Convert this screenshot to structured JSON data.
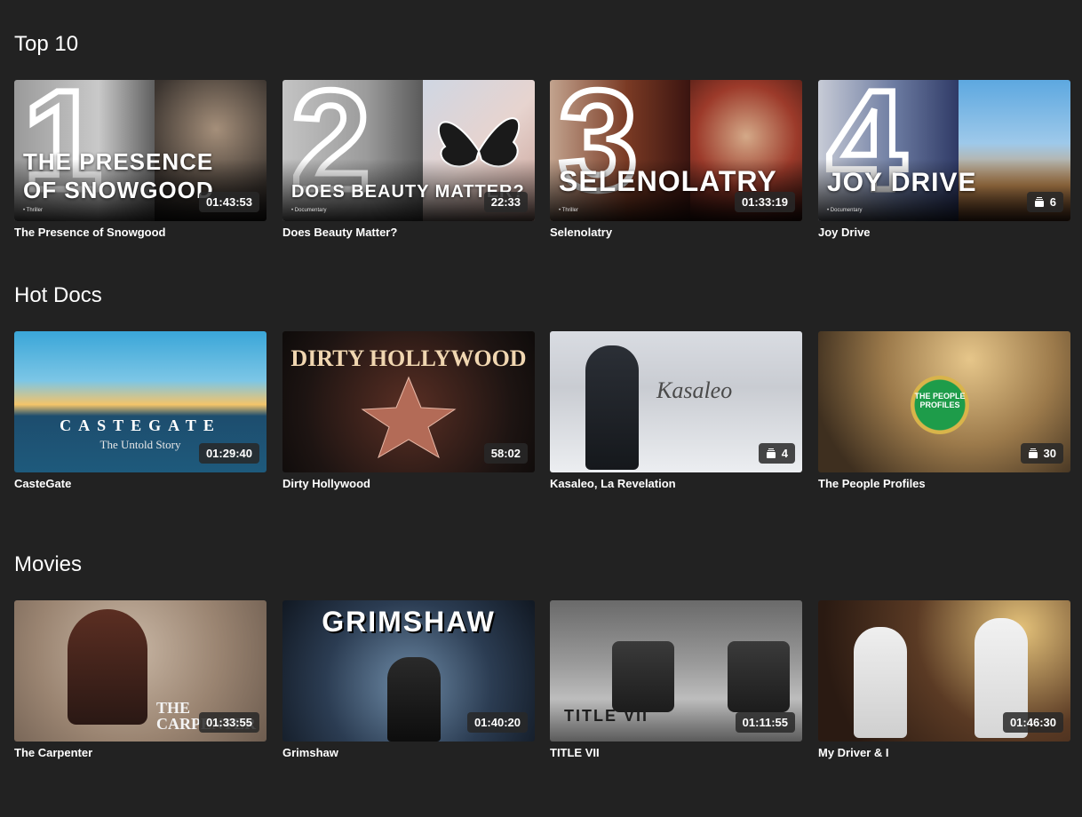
{
  "sections": [
    {
      "title": "Top 10",
      "items": [
        {
          "rank": "1",
          "title": "The Presence of Snowgood",
          "overlay": "THE PRESENCE OF SNOWGOOD",
          "genre": "• Thriller",
          "badge": "01:43:53"
        },
        {
          "rank": "2",
          "title": "Does Beauty Matter?",
          "overlay": "DOES BEAUTY MATTER?",
          "genre": "• Documentary",
          "badge": "22:33"
        },
        {
          "rank": "3",
          "title": "Selenolatry",
          "overlay": "SELENOLATRY",
          "genre": "• Thriller",
          "badge": "01:33:19"
        },
        {
          "rank": "4",
          "title": "Joy Drive",
          "overlay": "JOY DRIVE",
          "genre": "• Documentary",
          "badge": "6",
          "badge_icon": "episodes-icon"
        }
      ]
    },
    {
      "title": "Hot Docs",
      "items": [
        {
          "title": "CasteGate",
          "badge": "01:29:40",
          "poster_text": "CASTEGATE",
          "poster_sub": "The Untold Story"
        },
        {
          "title": "Dirty Hollywood",
          "badge": "58:02",
          "poster_text": "DIRTY HOLLYWOOD"
        },
        {
          "title": "Kasaleo, La Revelation",
          "badge": "4",
          "badge_icon": "episodes-icon",
          "poster_text": "Kasaleo"
        },
        {
          "title": "The People Profiles",
          "badge": "30",
          "badge_icon": "episodes-icon",
          "poster_text": "THE PEOPLE PROFILES"
        }
      ]
    },
    {
      "title": "Movies",
      "items": [
        {
          "title": "The Carpenter",
          "badge": "01:33:55",
          "poster_text": "THE CARPENTER"
        },
        {
          "title": "Grimshaw",
          "badge": "01:40:20",
          "poster_text": "GRIMSHAW"
        },
        {
          "title": "TITLE VII",
          "badge": "01:11:55",
          "poster_text": "TITLE VII"
        },
        {
          "title": "My Driver & I",
          "badge": "01:46:30"
        }
      ]
    }
  ],
  "colors": {
    "background": "#222222",
    "text": "#ffffff",
    "badge_bg": "#282828"
  }
}
